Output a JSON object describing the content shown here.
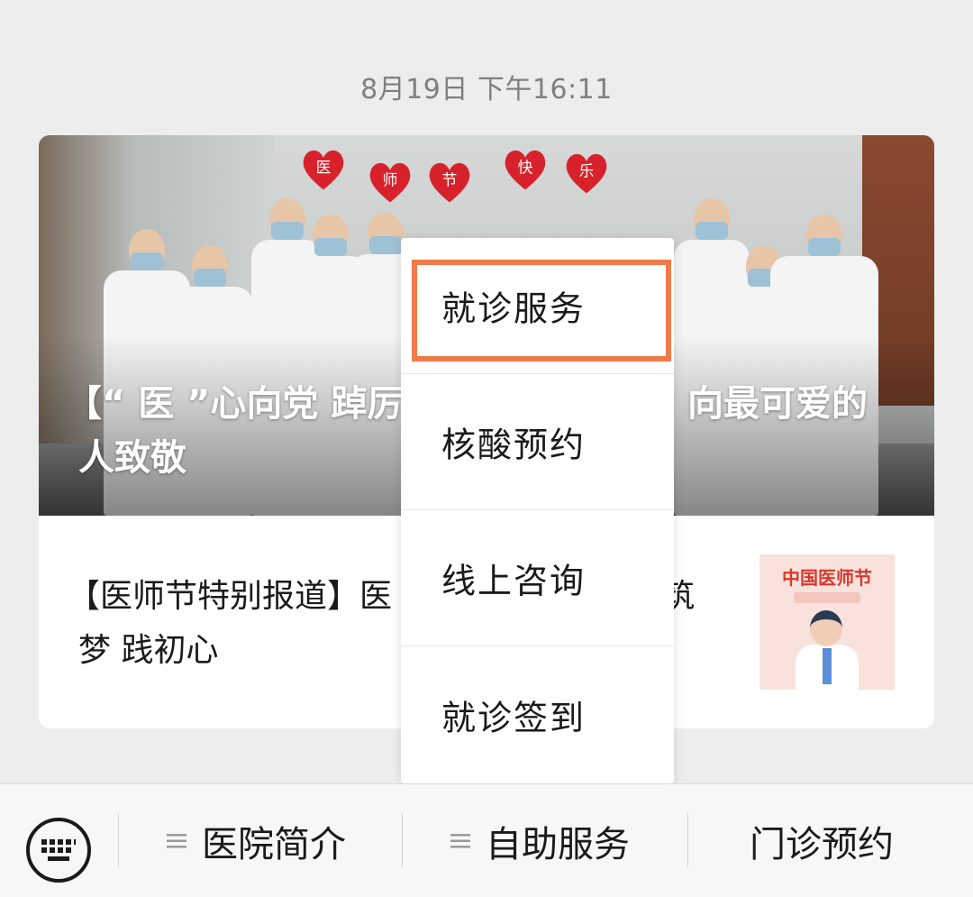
{
  "timestamp": "8月19日 下午16:11",
  "card": {
    "cover_title_line1": "【“ 医 ”心向党 踔厉",
    "cover_title_line1_right": "向最可爱的",
    "cover_title_line2": "人致敬",
    "balloon_chars": [
      "医",
      "师",
      "节",
      "快",
      "乐"
    ],
    "article_title_line1": "【医师节特别报道】医",
    "article_title_line1_right": "筑",
    "article_title_line2": "梦 践初心",
    "thumbnail": {
      "title": "中国医师节"
    }
  },
  "popup_menu": {
    "items": [
      {
        "label": "就诊服务",
        "highlighted": true
      },
      {
        "label": "核酸预约",
        "highlighted": false
      },
      {
        "label": "线上咨询",
        "highlighted": false
      },
      {
        "label": "就诊签到",
        "highlighted": false
      }
    ],
    "highlight_color": "#f07a4a"
  },
  "bottom_menu": {
    "keyboard_icon": "keyboard-icon",
    "tabs": [
      {
        "label": "医院简介",
        "has_submenu": true
      },
      {
        "label": "自助服务",
        "has_submenu": true
      },
      {
        "label": "门诊预约",
        "has_submenu": false
      }
    ]
  }
}
